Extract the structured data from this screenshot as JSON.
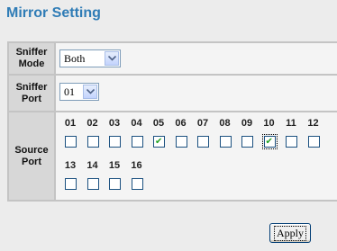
{
  "page": {
    "title": "Mirror Setting"
  },
  "sniffer_mode": {
    "label": "Sniffer Mode",
    "selected": "Both",
    "icon": "chevron-down-icon"
  },
  "sniffer_port": {
    "label": "Sniffer Port",
    "selected": "01",
    "icon": "chevron-down-icon"
  },
  "source_port": {
    "label": "Source Port",
    "rows": [
      {
        "ports": [
          {
            "num": "01",
            "checked": false
          },
          {
            "num": "02",
            "checked": false
          },
          {
            "num": "03",
            "checked": false
          },
          {
            "num": "04",
            "checked": false
          },
          {
            "num": "05",
            "checked": true
          },
          {
            "num": "06",
            "checked": false
          },
          {
            "num": "07",
            "checked": false
          },
          {
            "num": "08",
            "checked": false
          },
          {
            "num": "09",
            "checked": false
          },
          {
            "num": "10",
            "checked": true
          },
          {
            "num": "11",
            "checked": false
          },
          {
            "num": "12",
            "checked": false
          }
        ]
      },
      {
        "ports": [
          {
            "num": "13",
            "checked": false
          },
          {
            "num": "14",
            "checked": false
          },
          {
            "num": "15",
            "checked": false
          },
          {
            "num": "16",
            "checked": false
          }
        ]
      }
    ]
  },
  "actions": {
    "apply_label": "Apply"
  },
  "colors": {
    "title": "#2f7cb6",
    "checkbox_border": "#1c5180",
    "tick": "#21a121"
  }
}
